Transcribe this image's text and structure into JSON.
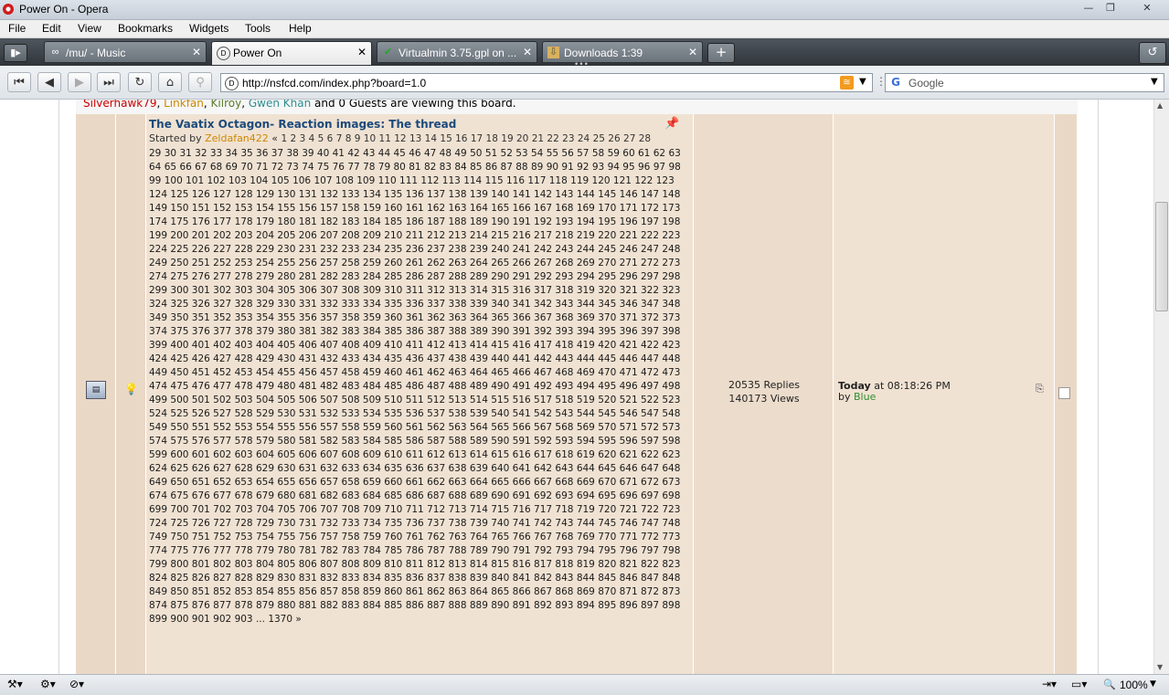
{
  "window": {
    "title": "Power On - Opera"
  },
  "menu": [
    "File",
    "Edit",
    "View",
    "Bookmarks",
    "Widgets",
    "Tools",
    "Help"
  ],
  "tabs": [
    {
      "label": "/mu/ - Music",
      "icon": "∞"
    },
    {
      "label": "Power On",
      "icon": "D"
    },
    {
      "label": "Virtualmin 3.75.gpl on ...",
      "icon": "✔"
    },
    {
      "label": "Downloads 1:39",
      "icon": "⇩"
    }
  ],
  "address": {
    "url": "http://nsfcd.com/index.php?board=1.0"
  },
  "search": {
    "placeholder": "Google"
  },
  "viewers": {
    "users": [
      {
        "name": "Silverhawk79",
        "color": "#cc0000"
      },
      {
        "name": "Linkfan",
        "color": "#cc8800"
      },
      {
        "name": "Kilroy",
        "color": "#5a7a2a"
      },
      {
        "name": "Gwen Khan",
        "color": "#2f8f8f"
      }
    ],
    "sep": ", ",
    "suffix": " and 0 Guests are viewing this board."
  },
  "topic": {
    "title": "The Vaatix Octagon- Reaction images: The thread",
    "started_prefix": "Started by ",
    "author": "Zeldafan422",
    "pages_open": "« ",
    "pages_last_shown": 903,
    "pages_ellipsis": " ... ",
    "pages_final": "1370",
    "pages_close": " »",
    "replies": "20535 Replies",
    "views": "140173 Views",
    "last_day": "Today",
    "last_time": " at 08:18:26 PM",
    "last_by_prefix": "by ",
    "last_by": "Blue"
  },
  "status": {
    "zoom": "100%"
  },
  "colors": {
    "row_bg": "#f0e2d2",
    "icon_cell_bg": "#ead8c6",
    "stats_bg": "#ecdccb",
    "title_color": "#1c4a7c"
  }
}
